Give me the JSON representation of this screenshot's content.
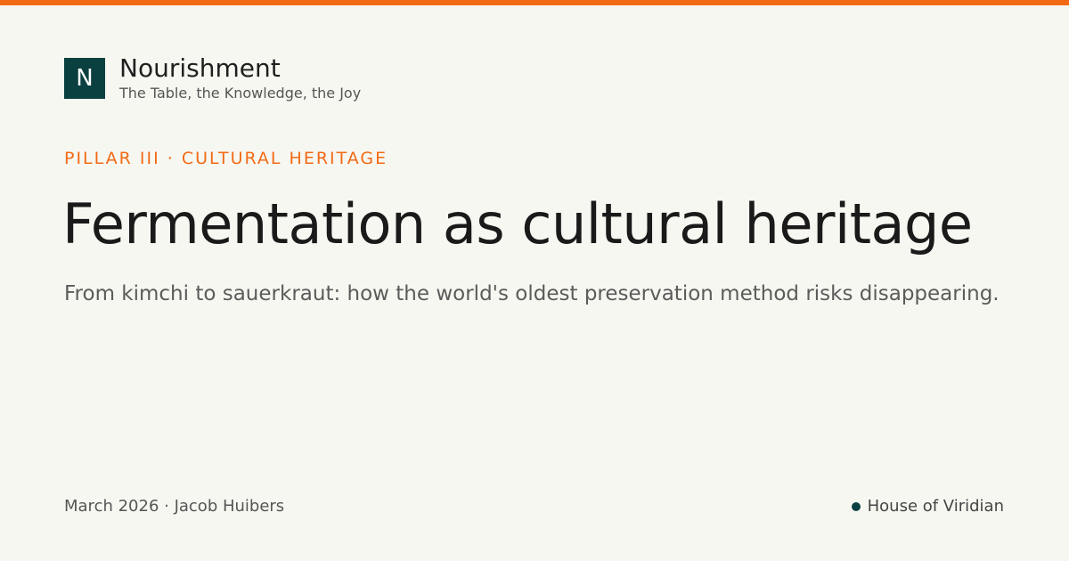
{
  "colors": {
    "accent": "#f26a14",
    "brand": "#0b4040",
    "background": "#f7f7f2"
  },
  "brand": {
    "logo_letter": "N",
    "name": "Nourishment",
    "tagline": "The Table, the Knowledge, the Joy"
  },
  "article": {
    "kicker": "PILLAR III · CULTURAL HERITAGE",
    "title": "Fermentation as cultural heritage",
    "subtitle": "From kimchi to sauerkraut: how the world's oldest preservation method risks disappearing."
  },
  "footer": {
    "byline": "March 2026 · Jacob Huibers",
    "publisher": "House of Viridian",
    "publisher_icon": "dot-icon"
  }
}
